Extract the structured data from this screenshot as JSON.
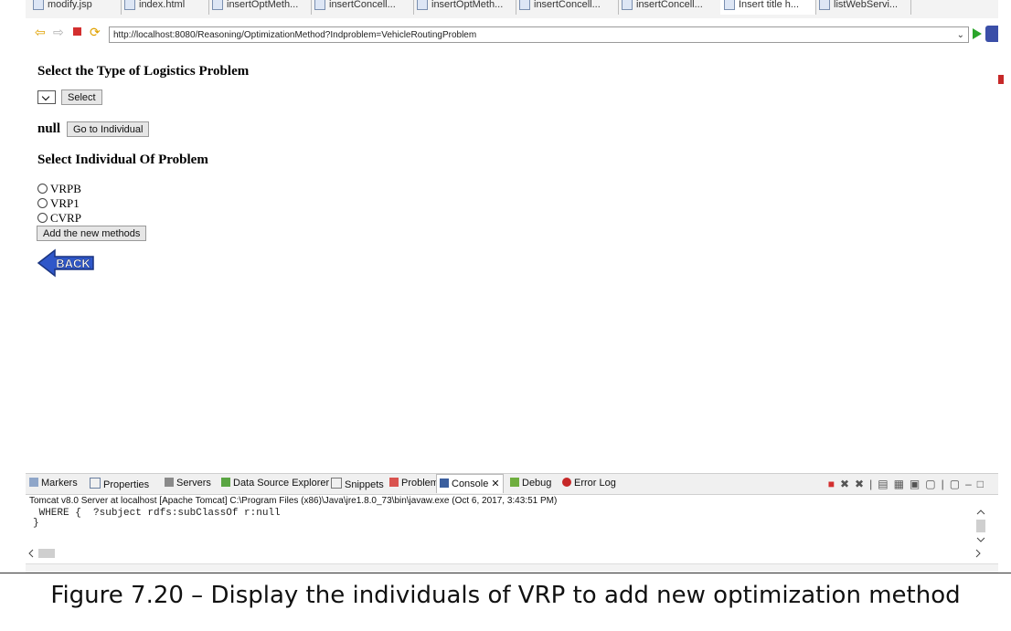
{
  "browser": {
    "tabs": [
      {
        "label": "modify.jsp"
      },
      {
        "label": "index.html"
      },
      {
        "label": "insertOptMeth..."
      },
      {
        "label": "insertConcell..."
      },
      {
        "label": "insertOptMeth..."
      },
      {
        "label": "insertConcell..."
      },
      {
        "label": "insertConcell..."
      },
      {
        "label": "Insert title h..."
      },
      {
        "label": "listWebServi..."
      }
    ],
    "url": "http://localhost:8080/Reasoning/OptimizationMethod?Indproblem=VehicleRoutingProblem",
    "icons": [
      "back-arrow-icon",
      "forward-arrow-icon",
      "stop-icon",
      "refresh-icon",
      "go-icon",
      "eclipse-icon"
    ]
  },
  "page": {
    "heading_type": "Select the Type of Logistics Problem",
    "select_button": "Select",
    "null_text": "null",
    "go_individual_button": "Go to Individual",
    "heading_individual": "Select Individual Of Problem",
    "options": [
      {
        "label": "VRPB"
      },
      {
        "label": "VRP1"
      },
      {
        "label": "CVRP"
      }
    ],
    "add_methods_button": "Add the new methods",
    "back_button": "BACK"
  },
  "ide": {
    "panel_tabs": [
      {
        "label": "Markers"
      },
      {
        "label": "Properties"
      },
      {
        "label": "Servers"
      },
      {
        "label": "Data Source Explorer"
      },
      {
        "label": "Snippets"
      },
      {
        "label": "Problems"
      },
      {
        "label": "Console"
      },
      {
        "label": "Debug"
      },
      {
        "label": "Error Log"
      }
    ],
    "status": "Tomcat v8.0 Server at localhost [Apache Tomcat] C:\\Program Files (x86)\\Java\\jre1.8.0_73\\bin\\javaw.exe (Oct 6, 2017, 3:43:51 PM)",
    "console_lines": [
      " WHERE {  ?subject rdfs:subClassOf r:null",
      "}"
    ]
  },
  "caption": "Figure 7.20 – Display the individuals of VRP to add new optimization method",
  "colors": {
    "go": "#2aa52a",
    "back_arrow": "#2f57c9",
    "stop": "#d32f2f"
  }
}
